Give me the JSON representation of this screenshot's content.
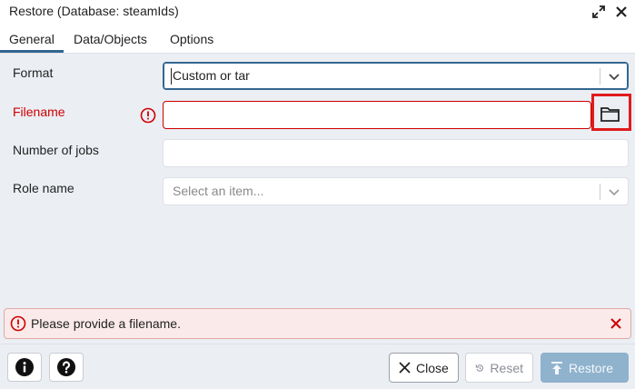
{
  "window": {
    "title": "Restore (Database: steamIds)",
    "expand_icon": "expand-arrows-icon",
    "close_icon": "close-icon"
  },
  "tabs": [
    {
      "label": "General",
      "active": true
    },
    {
      "label": "Data/Objects",
      "active": false
    },
    {
      "label": "Options",
      "active": false
    }
  ],
  "form": {
    "format": {
      "label": "Format",
      "value": "Custom or tar"
    },
    "filename": {
      "label": "Filename",
      "value": "",
      "error": true
    },
    "jobs": {
      "label": "Number of jobs",
      "value": ""
    },
    "role": {
      "label": "Role name",
      "placeholder": "Select an item..."
    }
  },
  "alert": {
    "message": "Please provide a filename.",
    "color": "#ce0000"
  },
  "footer": {
    "close_label": "Close",
    "reset_label": "Reset",
    "restore_label": "Restore"
  },
  "colors": {
    "accent": "#326690",
    "error": "#ce0000",
    "highlight": "#e01b1b"
  }
}
